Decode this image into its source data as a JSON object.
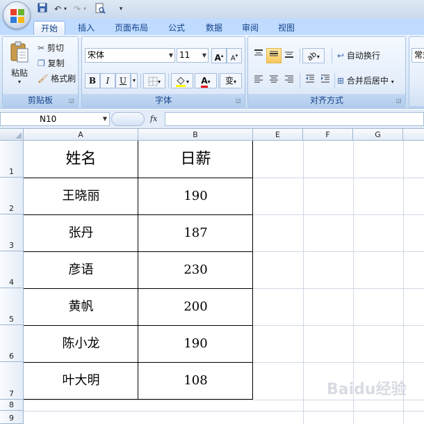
{
  "ribbon": {
    "tabs": [
      {
        "label": "开始",
        "active": true
      },
      {
        "label": "插入"
      },
      {
        "label": "页面布局"
      },
      {
        "label": "公式"
      },
      {
        "label": "数据"
      },
      {
        "label": "审阅"
      },
      {
        "label": "视图"
      }
    ],
    "clipboard": {
      "label": "剪贴板",
      "paste": "粘贴",
      "cut": "剪切",
      "copy": "复制",
      "format_painter": "格式刷"
    },
    "font": {
      "label": "字体",
      "font_name": "宋体",
      "font_size": "11",
      "bold": "B",
      "italic": "I",
      "underline": "U",
      "font_color_glyph": "A",
      "phonetic_glyph": "变"
    },
    "alignment": {
      "label": "对齐方式",
      "wrap_text": "自动换行",
      "merge_center": "合并后居中"
    },
    "number": {
      "format": "常规"
    }
  },
  "formula_bar": {
    "name_box": "N10",
    "fx": "fx",
    "formula": ""
  },
  "sheet": {
    "columns": [
      "A",
      "B",
      "E",
      "F",
      "G"
    ],
    "rows": [
      "1",
      "2",
      "3",
      "4",
      "5",
      "6",
      "7",
      "8",
      "9"
    ],
    "headers": [
      "姓名",
      "日薪"
    ],
    "records": [
      {
        "name": "王晓丽",
        "wage": "190"
      },
      {
        "name": "张丹",
        "wage": "187"
      },
      {
        "name": "彦语",
        "wage": "230"
      },
      {
        "name": "黄帆",
        "wage": "200"
      },
      {
        "name": "陈小龙",
        "wage": "190"
      },
      {
        "name": "叶大明",
        "wage": "108"
      }
    ]
  },
  "watermark": "Baidu经验",
  "colors": {
    "ribbon_bg": "#dce8f8",
    "tab_text": "#15428b",
    "grid_line": "#d0d7e5",
    "table_border": "#000000",
    "font_color_bar": "#e81010",
    "fill_color_bar": "#ffff00"
  }
}
